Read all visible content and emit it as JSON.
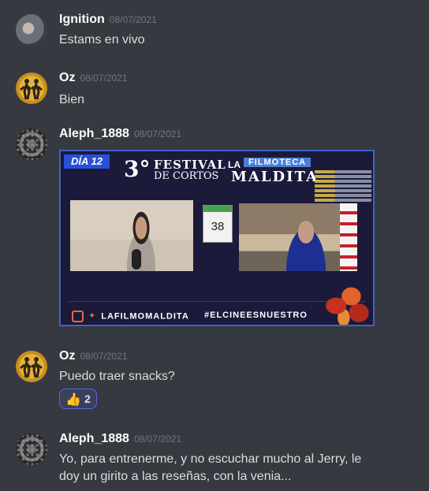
{
  "messages": [
    {
      "author": "Ignition",
      "timestamp": "08/07/2021",
      "text": "Estams en vivo"
    },
    {
      "author": "Oz",
      "timestamp": "08/07/2021",
      "text": "Bien"
    },
    {
      "author": "Aleph_1888",
      "timestamp": "08/07/2021"
    },
    {
      "author": "Oz",
      "timestamp": "08/07/2021",
      "text": "Puedo traer snacks?",
      "reaction": {
        "emoji": "thumbs-up",
        "count": "2"
      }
    },
    {
      "author": "Aleph_1888",
      "timestamp": "08/07/2021",
      "text": "Yo, para entrenerme, y no escuchar mucho al Jerry, le doy un girito a las reseñas, con la venia..."
    }
  ],
  "embed": {
    "day_badge": "DÍA 12",
    "festival_number": "3°",
    "festival_line1": "FESTIVAL",
    "festival_line2": "DE CORTOS",
    "brand_prefix": "LA",
    "brand_top": "FILMOTECA",
    "brand_bottom": "MALDITA",
    "counter_value": "38",
    "social_handle": "LAFILMOMALDITA",
    "hashtag": "#ELCINEESNUESTRO"
  },
  "colors": {
    "background": "#36393f",
    "username": "#ffffff",
    "timestamp": "#72767d",
    "message_text": "#dcddde",
    "reaction_border": "#5865f2"
  }
}
